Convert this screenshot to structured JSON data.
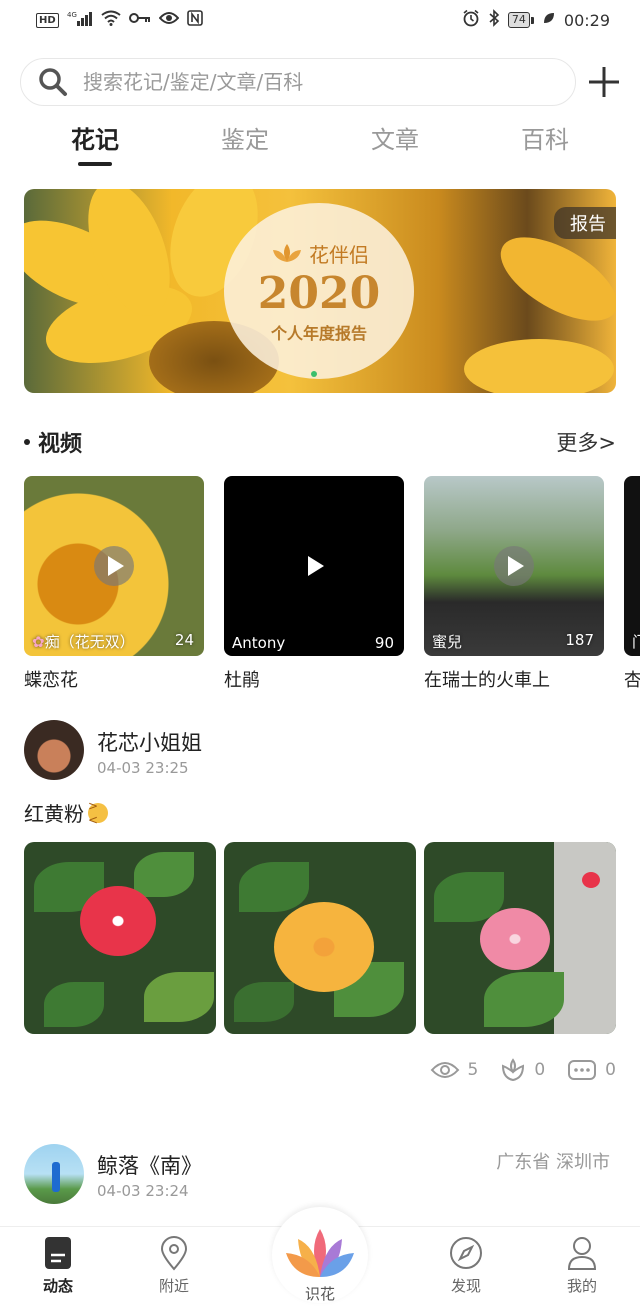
{
  "status_bar": {
    "network": "HD",
    "signal": "4G",
    "battery": "74",
    "time": "00:29"
  },
  "search": {
    "placeholder": "搜索花记/鉴定/文章/百科"
  },
  "tabs": [
    {
      "label": "花记",
      "active": true
    },
    {
      "label": "鉴定",
      "active": false
    },
    {
      "label": "文章",
      "active": false
    },
    {
      "label": "百科",
      "active": false
    }
  ],
  "banner": {
    "brand": "花伴侣",
    "year": "2020",
    "subtitle": "个人年度报告",
    "tag": "报告"
  },
  "videos_section": {
    "title": "视频",
    "more": "更多>",
    "items": [
      {
        "author": "痴（花无双）",
        "count": "24",
        "title": "蝶恋花"
      },
      {
        "author": "Antony",
        "count": "90",
        "title": "杜鹃"
      },
      {
        "author": "蜜兒",
        "count": "187",
        "title": "在瑞士的火車上"
      },
      {
        "author": "门",
        "count": "",
        "title": "杏"
      }
    ]
  },
  "post1": {
    "username": "花芯小姐姐",
    "time": "04-03 23:25",
    "text": "红黄粉",
    "views": "5",
    "likes": "0",
    "comments": "0"
  },
  "post2": {
    "username": "鲸落《南》",
    "time": "04-03 23:24",
    "location": "广东省 深圳市"
  },
  "bottom_nav": {
    "items": [
      {
        "label": "动态"
      },
      {
        "label": "附近"
      },
      {
        "label": "识花"
      },
      {
        "label": "发现"
      },
      {
        "label": "我的"
      }
    ]
  },
  "colors": {
    "accent": "#222222",
    "muted": "#999999",
    "banner_gold": "#c7862e"
  }
}
